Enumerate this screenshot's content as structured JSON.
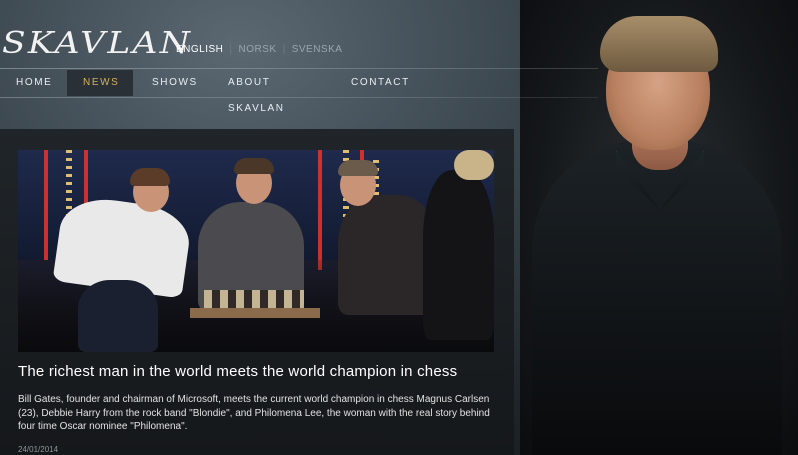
{
  "site": {
    "logo_text": "SKAVLAN"
  },
  "languages": [
    {
      "label": "ENGLISH",
      "active": true
    },
    {
      "label": "NORSK",
      "active": false
    },
    {
      "label": "SVENSKA",
      "active": false
    }
  ],
  "nav": {
    "items": [
      {
        "label": "HOME",
        "active": false
      },
      {
        "label": "NEWS",
        "active": true
      },
      {
        "label": "SHOWS",
        "active": false
      },
      {
        "label": "ABOUT SKAVLAN",
        "active": false
      },
      {
        "label": "CONTACT",
        "active": false
      }
    ]
  },
  "article": {
    "headline": "The richest man in the world meets the world champion in chess",
    "summary": "Bill Gates, founder and chairman of Microsoft, meets the current world champion in chess Magnus Carlsen (23), Debbie Harry from the rock band \"Blondie\", and Philomena Lee, the woman with the real story behind four time Oscar nominee \"Philomena\".",
    "date": "24/01/2014"
  },
  "colors": {
    "nav_active_text": "#d3b15e",
    "accent_light": "#e0332c"
  }
}
